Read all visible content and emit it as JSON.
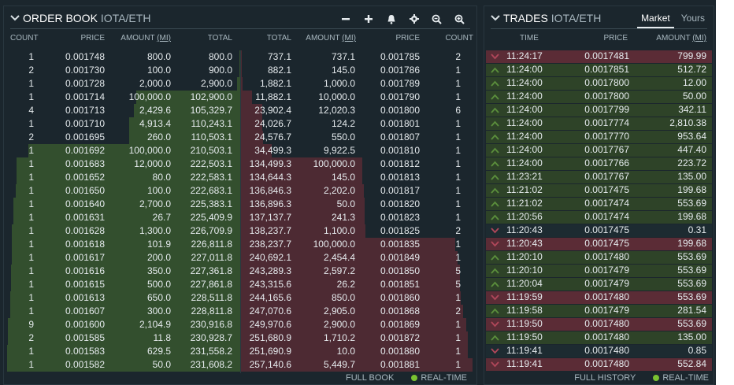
{
  "order_book": {
    "title": "ORDER BOOK",
    "pair": "IOTA/ETH",
    "icons": [
      "minus-icon",
      "plus-icon",
      "bell-icon",
      "gear-icon",
      "zoom-out-icon",
      "zoom-in-icon"
    ],
    "columns": {
      "count": "COUNT",
      "price": "PRICE",
      "amount": "AMOUNT",
      "amount_unit": "(MI)",
      "total": "TOTAL",
      "ask_total": "TOTAL",
      "ask_amount": "AMOUNT",
      "ask_amount_unit": "(MI)",
      "ask_price": "PRICE",
      "ask_count": "COUNT"
    },
    "bids": [
      {
        "count": "1",
        "price": "0.001748",
        "amount": "800.0",
        "total": "800.0"
      },
      {
        "count": "2",
        "price": "0.001730",
        "amount": "100.0",
        "total": "900.0"
      },
      {
        "count": "1",
        "price": "0.001728",
        "amount": "2,000.0",
        "total": "2,900.0"
      },
      {
        "count": "1",
        "price": "0.001714",
        "amount": "100,000.0",
        "total": "102,900.0"
      },
      {
        "count": "4",
        "price": "0.001713",
        "amount": "2,429.6",
        "total": "105,329.7"
      },
      {
        "count": "1",
        "price": "0.001710",
        "amount": "4,913.4",
        "total": "110,243.1"
      },
      {
        "count": "2",
        "price": "0.001695",
        "amount": "260.0",
        "total": "110,503.1"
      },
      {
        "count": "1",
        "price": "0.001692",
        "amount": "100,000.0",
        "total": "210,503.1"
      },
      {
        "count": "1",
        "price": "0.001683",
        "amount": "12,000.0",
        "total": "222,503.1"
      },
      {
        "count": "1",
        "price": "0.001652",
        "amount": "80.0",
        "total": "222,583.1"
      },
      {
        "count": "1",
        "price": "0.001650",
        "amount": "100.0",
        "total": "222,683.1"
      },
      {
        "count": "1",
        "price": "0.001640",
        "amount": "2,700.0",
        "total": "225,383.1"
      },
      {
        "count": "1",
        "price": "0.001631",
        "amount": "26.7",
        "total": "225,409.9"
      },
      {
        "count": "1",
        "price": "0.001628",
        "amount": "1,300.0",
        "total": "226,709.9"
      },
      {
        "count": "1",
        "price": "0.001618",
        "amount": "101.9",
        "total": "226,811.8"
      },
      {
        "count": "1",
        "price": "0.001617",
        "amount": "200.0",
        "total": "227,011.8"
      },
      {
        "count": "1",
        "price": "0.001616",
        "amount": "350.0",
        "total": "227,361.8"
      },
      {
        "count": "1",
        "price": "0.001615",
        "amount": "500.0",
        "total": "227,861.8"
      },
      {
        "count": "1",
        "price": "0.001613",
        "amount": "650.0",
        "total": "228,511.8"
      },
      {
        "count": "1",
        "price": "0.001607",
        "amount": "300.0",
        "total": "228,811.8"
      },
      {
        "count": "9",
        "price": "0.001600",
        "amount": "2,104.9",
        "total": "230,916.8"
      },
      {
        "count": "2",
        "price": "0.001585",
        "amount": "11.8",
        "total": "230,928.7"
      },
      {
        "count": "1",
        "price": "0.001583",
        "amount": "629.5",
        "total": "231,558.2"
      },
      {
        "count": "1",
        "price": "0.001582",
        "amount": "50.0",
        "total": "231,608.2"
      }
    ],
    "asks": [
      {
        "total": "737.1",
        "amount": "737.1",
        "price": "0.001785",
        "count": "2"
      },
      {
        "total": "882.1",
        "amount": "145.0",
        "price": "0.001786",
        "count": "1"
      },
      {
        "total": "1,882.1",
        "amount": "1,000.0",
        "price": "0.001789",
        "count": "1"
      },
      {
        "total": "11,882.1",
        "amount": "10,000.0",
        "price": "0.001790",
        "count": "1"
      },
      {
        "total": "23,902.4",
        "amount": "12,020.3",
        "price": "0.001800",
        "count": "6"
      },
      {
        "total": "24,026.7",
        "amount": "124.2",
        "price": "0.001801",
        "count": "1"
      },
      {
        "total": "24,576.7",
        "amount": "550.0",
        "price": "0.001807",
        "count": "1"
      },
      {
        "total": "34,499.3",
        "amount": "9,922.5",
        "price": "0.001810",
        "count": "1"
      },
      {
        "total": "134,499.3",
        "amount": "100,000.0",
        "price": "0.001812",
        "count": "1"
      },
      {
        "total": "134,644.3",
        "amount": "145.0",
        "price": "0.001813",
        "count": "1"
      },
      {
        "total": "136,846.3",
        "amount": "2,202.0",
        "price": "0.001817",
        "count": "1"
      },
      {
        "total": "136,896.3",
        "amount": "50.0",
        "price": "0.001820",
        "count": "1"
      },
      {
        "total": "137,137.7",
        "amount": "241.3",
        "price": "0.001823",
        "count": "1"
      },
      {
        "total": "138,237.7",
        "amount": "1,100.0",
        "price": "0.001825",
        "count": "2"
      },
      {
        "total": "238,237.7",
        "amount": "100,000.0",
        "price": "0.001835",
        "count": "1"
      },
      {
        "total": "240,692.1",
        "amount": "2,454.4",
        "price": "0.001849",
        "count": "1"
      },
      {
        "total": "243,289.3",
        "amount": "2,597.2",
        "price": "0.001850",
        "count": "5"
      },
      {
        "total": "243,315.6",
        "amount": "26.2",
        "price": "0.001851",
        "count": "5"
      },
      {
        "total": "244,165.6",
        "amount": "850.0",
        "price": "0.001860",
        "count": "1"
      },
      {
        "total": "247,070.6",
        "amount": "2,905.0",
        "price": "0.001868",
        "count": "2"
      },
      {
        "total": "249,970.6",
        "amount": "2,900.0",
        "price": "0.001869",
        "count": "1"
      },
      {
        "total": "251,680.9",
        "amount": "1,710.2",
        "price": "0.001872",
        "count": "1"
      },
      {
        "total": "251,690.9",
        "amount": "10.0",
        "price": "0.001880",
        "count": "1"
      },
      {
        "total": "257,140.6",
        "amount": "5,449.7",
        "price": "0.001881",
        "count": "1"
      }
    ],
    "footer": {
      "full_book": "FULL BOOK",
      "realtime": "REAL-TIME"
    }
  },
  "trades": {
    "title": "TRADES",
    "pair": "IOTA/ETH",
    "tabs": [
      {
        "label": "Market",
        "active": true
      },
      {
        "label": "Yours",
        "active": false
      }
    ],
    "columns": {
      "time": "TIME",
      "price": "PRICE",
      "amount": "AMOUNT",
      "amount_unit": "(MI)"
    },
    "rows": [
      {
        "side": "sell",
        "time": "11:24:17",
        "price": "0.0017481",
        "amount": "799.99"
      },
      {
        "side": "buy",
        "time": "11:24:00",
        "price": "0.0017851",
        "amount": "512.72"
      },
      {
        "side": "buy",
        "time": "11:24:00",
        "price": "0.0017800",
        "amount": "12.00"
      },
      {
        "side": "buy",
        "time": "11:24:00",
        "price": "0.0017800",
        "amount": "50.00"
      },
      {
        "side": "buy",
        "time": "11:24:00",
        "price": "0.0017799",
        "amount": "342.11"
      },
      {
        "side": "buy",
        "time": "11:24:00",
        "price": "0.0017774",
        "amount": "2,810.38"
      },
      {
        "side": "buy",
        "time": "11:24:00",
        "price": "0.0017770",
        "amount": "953.64"
      },
      {
        "side": "buy",
        "time": "11:24:00",
        "price": "0.0017767",
        "amount": "447.40"
      },
      {
        "side": "buy",
        "time": "11:24:00",
        "price": "0.0017766",
        "amount": "223.72"
      },
      {
        "side": "buy",
        "time": "11:23:21",
        "price": "0.0017767",
        "amount": "135.00"
      },
      {
        "side": "buy",
        "time": "11:21:02",
        "price": "0.0017475",
        "amount": "199.68"
      },
      {
        "side": "buy",
        "time": "11:21:02",
        "price": "0.0017474",
        "amount": "553.69"
      },
      {
        "side": "buy",
        "time": "11:20:56",
        "price": "0.0017474",
        "amount": "199.68"
      },
      {
        "side": "plain",
        "time": "11:20:43",
        "price": "0.0017475",
        "amount": "0.31"
      },
      {
        "side": "sell",
        "time": "11:20:43",
        "price": "0.0017475",
        "amount": "199.68"
      },
      {
        "side": "buy",
        "time": "11:20:10",
        "price": "0.0017480",
        "amount": "553.69"
      },
      {
        "side": "buy",
        "time": "11:20:10",
        "price": "0.0017479",
        "amount": "553.69"
      },
      {
        "side": "buy",
        "time": "11:20:04",
        "price": "0.0017479",
        "amount": "553.69"
      },
      {
        "side": "sell",
        "time": "11:19:59",
        "price": "0.0017480",
        "amount": "553.69"
      },
      {
        "side": "buy",
        "time": "11:19:58",
        "price": "0.0017479",
        "amount": "281.54"
      },
      {
        "side": "sell",
        "time": "11:19:50",
        "price": "0.0017480",
        "amount": "553.69"
      },
      {
        "side": "buy",
        "time": "11:19:50",
        "price": "0.0017480",
        "amount": "135.00"
      },
      {
        "side": "plain",
        "time": "11:19:41",
        "price": "0.0017480",
        "amount": "0.85"
      },
      {
        "side": "sell",
        "time": "11:19:41",
        "price": "0.0017480",
        "amount": "552.84"
      }
    ],
    "footer": {
      "full_history": "FULL HISTORY",
      "realtime": "REAL-TIME"
    }
  },
  "colors": {
    "bid": "#334f2e",
    "ask": "#4d2a33",
    "buy_arrow": "#5b8f3c",
    "sell_arrow": "#b0475a",
    "live": "#7ac231"
  }
}
